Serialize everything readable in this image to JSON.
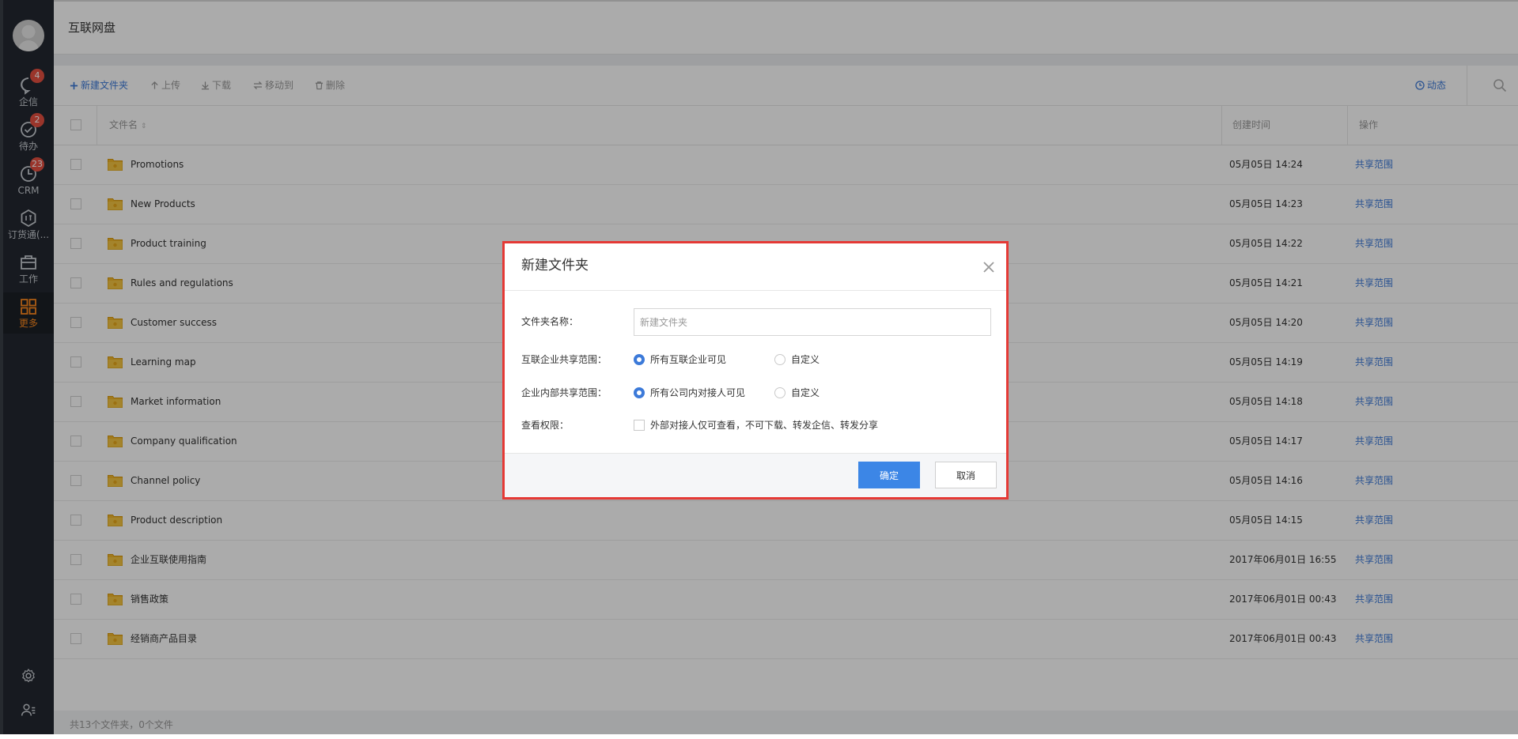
{
  "sidebar": {
    "avatar": "user-avatar",
    "items": [
      {
        "label": "企信",
        "icon": "chat-bubble-icon",
        "badge": "4"
      },
      {
        "label": "待办",
        "icon": "check-circle-icon",
        "badge": "2"
      },
      {
        "label": "CRM",
        "icon": "clock-icon",
        "badge": "23"
      },
      {
        "label": "订货通(...",
        "icon": "hexagon-order-icon",
        "badge": ""
      },
      {
        "label": "工作",
        "icon": "briefcase-icon",
        "badge": ""
      },
      {
        "label": "更多",
        "icon": "grid-icon",
        "badge": ""
      }
    ],
    "active_color": "#ff8a1e"
  },
  "header": {
    "title": "互联网盘"
  },
  "toolbar": {
    "new_folder": "新建文件夹",
    "upload": "上传",
    "download": "下载",
    "move_to": "移动到",
    "delete": "删除",
    "activity": "动态"
  },
  "table": {
    "headers": {
      "name": "文件名",
      "created": "创建时间",
      "action": "操作"
    },
    "rows": [
      {
        "name": "Promotions",
        "time": "05月05日 14:24",
        "action": "共享范围"
      },
      {
        "name": "New Products",
        "time": "05月05日 14:23",
        "action": "共享范围"
      },
      {
        "name": "Product training",
        "time": "05月05日 14:22",
        "action": "共享范围"
      },
      {
        "name": "Rules and regulations",
        "time": "05月05日 14:21",
        "action": "共享范围"
      },
      {
        "name": "Customer success",
        "time": "05月05日 14:20",
        "action": "共享范围"
      },
      {
        "name": "Learning map",
        "time": "05月05日 14:19",
        "action": "共享范围"
      },
      {
        "name": "Market information",
        "time": "05月05日 14:18",
        "action": "共享范围"
      },
      {
        "name": "Company qualification",
        "time": "05月05日 14:17",
        "action": "共享范围"
      },
      {
        "name": "Channel policy",
        "time": "05月05日 14:16",
        "action": "共享范围"
      },
      {
        "name": "Product description",
        "time": "05月05日 14:15",
        "action": "共享范围"
      },
      {
        "name": "企业互联使用指南",
        "time": "2017年06月01日 16:55",
        "action": "共享范围"
      },
      {
        "name": "销售政策",
        "time": "2017年06月01日 00:43",
        "action": "共享范围"
      },
      {
        "name": "经销商产品目录",
        "time": "2017年06月01日 00:43",
        "action": "共享范围"
      }
    ]
  },
  "footer": {
    "summary": "共13个文件夹，0个文件"
  },
  "dialog": {
    "title": "新建文件夹",
    "folder_name_label": "文件夹名称：",
    "folder_name_placeholder": "新建文件夹",
    "folder_name_value": "",
    "interconnect_scope_label": "互联企业共享范围：",
    "interconnect_options": [
      "所有互联企业可见",
      "自定义"
    ],
    "interconnect_selected": "所有互联企业可见",
    "internal_scope_label": "企业内部共享范围：",
    "internal_options": [
      "所有公司内对接人可见",
      "自定义"
    ],
    "internal_selected": "所有公司内对接人可见",
    "view_permission_label": "查看权限：",
    "view_permission_option": "外部对接人仅可查看，不可下载、转发企信、转发分享",
    "view_permission_checked": false,
    "confirm": "确定",
    "cancel": "取消",
    "highlight_color": "#e53935",
    "primary_color": "#3c86e6"
  }
}
